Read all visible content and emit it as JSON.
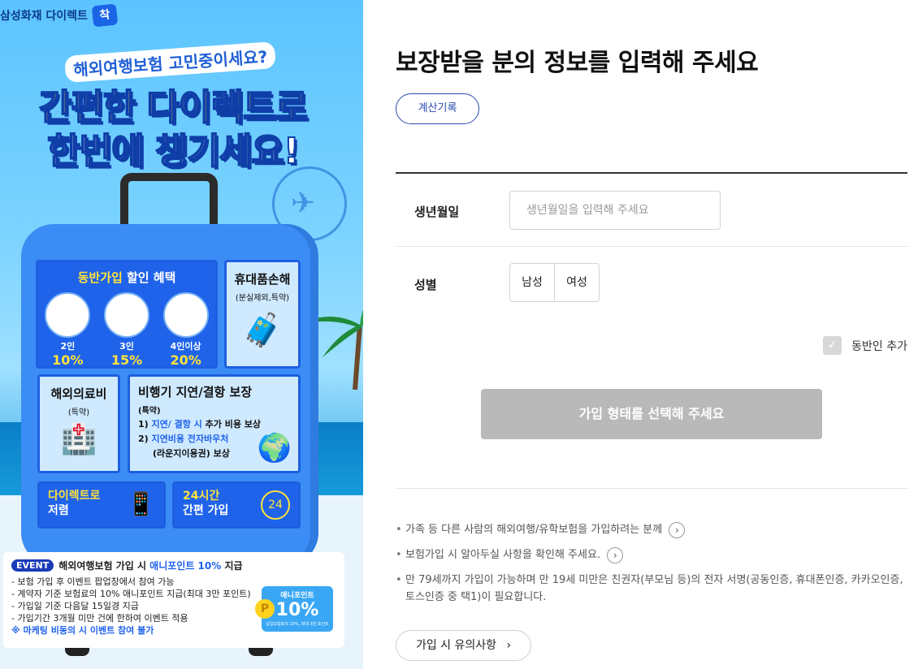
{
  "banner": {
    "brand": "삼성화재 다이렉트",
    "brand_badge": "착",
    "tagline": "해외여행보험 고민중이세요?",
    "headline1": "간편한 다이렉트로",
    "headline2": "한번에 챙기세요!",
    "group_discount": {
      "title_hl": "동반가입",
      "title_rest": " 할인 혜택",
      "tiers": [
        {
          "label": "2인",
          "pct": "10%"
        },
        {
          "label": "3인",
          "pct": "15%"
        },
        {
          "label": "4인이상",
          "pct": "20%"
        }
      ]
    },
    "belongings": {
      "title": "휴대품손해",
      "sub": "(분실제외,특약)"
    },
    "medical": {
      "title": "해외의료비",
      "sub": "(특약)"
    },
    "flight": {
      "title": "비행기 지연/결항 보장",
      "sub": "(특약)",
      "line1_a": "1) ",
      "line1_b": "지연/ 결항 시",
      "line1_c": " 추가 비용 보상",
      "line2_a": "2) ",
      "line2_b": "지연비용 전자바우처",
      "line3": "(라운지이용권) 보상"
    },
    "cheap": {
      "t1": "다이렉트로",
      "t2": "저렴"
    },
    "anytime": {
      "t1": "24시간",
      "t2": "간편 가입",
      "icon_text": "24"
    },
    "event": {
      "tag": "EVENT",
      "head_a": "해외여행보험 가입 시 ",
      "head_b": "애니포인트 10%",
      "head_c": " 지급",
      "items": [
        "- 보험 가입 후 이벤트 팝업창에서 참여 가능",
        "- 계약자 기준 보험료의 10% 애니포인트 지급(최대 3만 포인트)",
        "- 가입일 기준 다음달 15일경 지급",
        "- 가입기간 3개월 미만 건에 한하여 이벤트 적용"
      ],
      "note": "※ 마케팅 비동의 시 이벤트 참여 불가",
      "point_label": "애니포인트",
      "point_pct": "10%",
      "point_fine": "납입보험료의 10%, 최대 3만 포인트",
      "coin": "P"
    }
  },
  "form": {
    "title": "보장받을 분의 정보를 입력해 주세요",
    "history_button": "계산기록",
    "birth_label": "생년월일",
    "birth_placeholder": "생년월일을 입력해 주세요",
    "birth_value": "",
    "gender_label": "성별",
    "gender_options": [
      "남성",
      "여성"
    ],
    "companion_label": "동반인 추가",
    "submit_label": "가입 형태를 선택해 주세요",
    "notes": [
      "가족 등 다른 사람의 해외여행/유학보험을 가입하려는 분께",
      "보험가입 시 알아두실 사항을 확인해 주세요.",
      "만 79세까지 가입이 가능하며 만 19세 미만은 친권자(부모님 등)의 전자 서명(공동인증, 휴대폰인증, 카카오인증, 토스인증 중 택1)이 필요합니다."
    ],
    "caution_button": "가입 시 유의사항",
    "arrow_glyph": "›"
  },
  "colors": {
    "accent": "#2a4bb0",
    "submit_disabled": "#b9b9b9",
    "banner_card": "#1f63ea",
    "highlight_yellow": "#ffe23b"
  }
}
